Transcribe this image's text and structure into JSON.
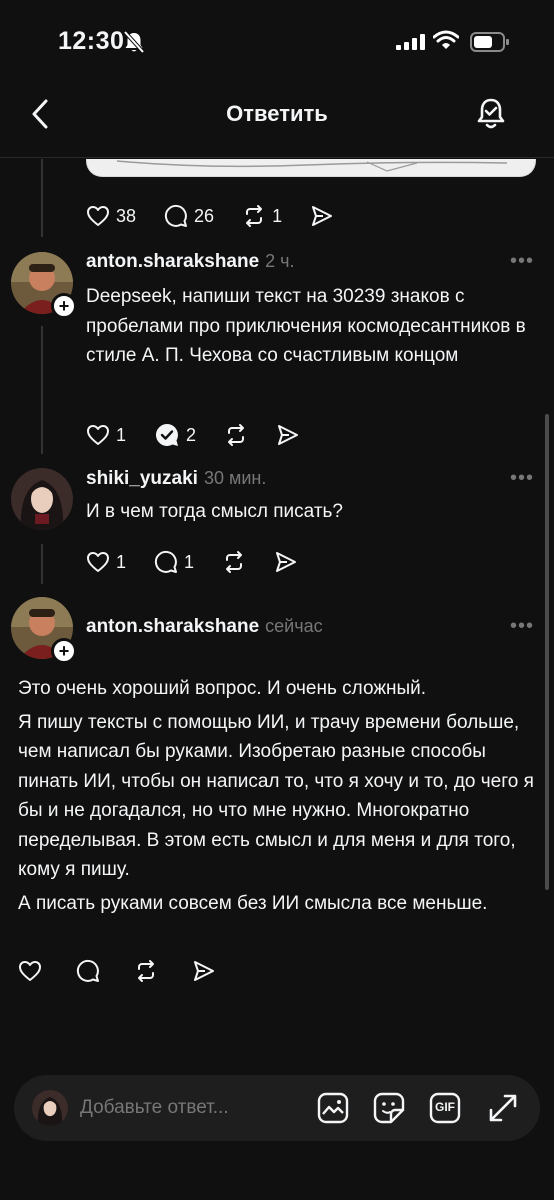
{
  "status_bar": {
    "time": "12:30"
  },
  "header": {
    "title": "Ответить"
  },
  "previous_post": {
    "likes": "38",
    "replies": "26",
    "reposts": "1"
  },
  "posts": [
    {
      "username": "anton.sharakshane",
      "time": "2 ч.",
      "more": "•••",
      "text": "Deepseek, напиши текст на 30239 знаков с пробелами про приключения космодесантников в стиле А. П. Чехова со счастливым концом",
      "likes": "1",
      "replies": "2"
    },
    {
      "username": "shiki_yuzaki",
      "time": "30 мин.",
      "more": "•••",
      "text": "И в чем тогда смысл писать?",
      "likes": "1",
      "replies": "1"
    },
    {
      "username": "anton.sharakshane",
      "time": "сейчас",
      "more": "•••",
      "paragraphs": [
        "Это очень хороший вопрос. И очень сложный.",
        "Я пишу тексты с помощью ИИ, и трачу времени больше, чем написал бы руками. Изобретаю разные способы пинать ИИ, чтобы он написал то, что я хочу и то, до чего я бы и не догадался, но что мне нужно. Многократно переделывая. В этом есть смысл и для меня и для того, кому я пишу.",
        "А писать руками совсем без ИИ смысла все меньше."
      ]
    }
  ],
  "composer": {
    "placeholder": "Добавьте ответ...",
    "gif_label": "GIF"
  },
  "colors": {
    "background": "#101010",
    "text": "#f3f5f7",
    "muted": "#777777"
  },
  "icons": [
    "bell-slash-icon",
    "signal-icon",
    "wifi-icon",
    "battery-icon",
    "back-icon",
    "notification-bell-icon",
    "heart-icon",
    "comment-icon",
    "repost-icon",
    "share-icon",
    "image-icon",
    "sticker-icon",
    "gif-icon",
    "expand-icon"
  ]
}
